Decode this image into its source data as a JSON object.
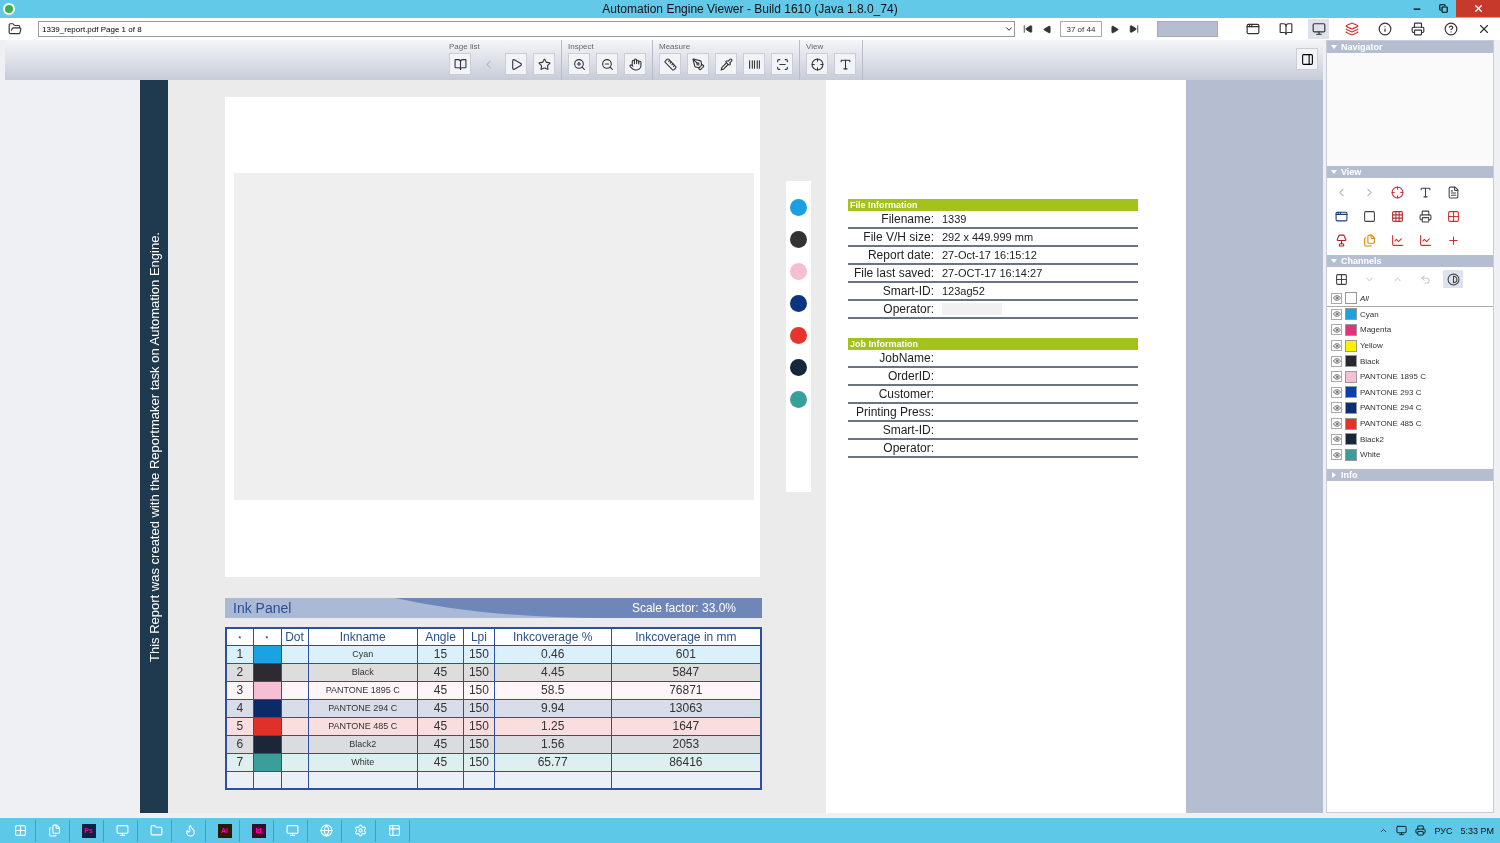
{
  "window": {
    "title": "Automation Engine Viewer - Build 1610 (Java 1.8.0_74)"
  },
  "address_bar": {
    "document": "1339_report.pdf Page 1 of 8",
    "page": "37 of 44"
  },
  "toolbar": {
    "groups": [
      {
        "label": "Page list"
      },
      {
        "label": "Inspect"
      },
      {
        "label": "Measure"
      },
      {
        "label": "View"
      }
    ]
  },
  "report": {
    "side_note": "This Report was created with the Reportmaker task on Automation Engine.",
    "dots": [
      {
        "color": "#1aa0e0"
      },
      {
        "color": "#333333"
      },
      {
        "color": "#f7bdd2"
      },
      {
        "color": "#0a3580"
      },
      {
        "color": "#e8332a"
      },
      {
        "color": "#15273a"
      },
      {
        "color": "#3a9e9a"
      }
    ],
    "ink_panel": {
      "title": "Ink Panel",
      "scale": "Scale factor: 33.0%",
      "columns": [
        "⋆",
        "⋆",
        "Dot",
        "Inkname",
        "Angle",
        "Lpi",
        "Inkcoverage %",
        "Inkcoverage in mm"
      ],
      "rows": [
        {
          "index": "1",
          "color": "#1aa3e2",
          "name": "Cyan",
          "angle": "15",
          "lpi": "150",
          "coverage": "0.46",
          "coverage_mm": "601"
        },
        {
          "index": "2",
          "color": "#2e2a33",
          "name": "Black",
          "angle": "45",
          "lpi": "150",
          "coverage": "4.45",
          "coverage_mm": "5847"
        },
        {
          "index": "3",
          "color": "#f7bfd4",
          "name": "PANTONE 1895 C",
          "angle": "45",
          "lpi": "150",
          "coverage": "58.5",
          "coverage_mm": "76871"
        },
        {
          "index": "4",
          "color": "#0b2a66",
          "name": "PANTONE 294 C",
          "angle": "45",
          "lpi": "150",
          "coverage": "9.94",
          "coverage_mm": "13063"
        },
        {
          "index": "5",
          "color": "#e0302b",
          "name": "PANTONE 485 C",
          "angle": "45",
          "lpi": "150",
          "coverage": "1.25",
          "coverage_mm": "1647"
        },
        {
          "index": "6",
          "color": "#1b2638",
          "name": "Black2",
          "angle": "45",
          "lpi": "150",
          "coverage": "1.56",
          "coverage_mm": "2053"
        },
        {
          "index": "7",
          "color": "#3a9e9b",
          "name": "White",
          "angle": "45",
          "lpi": "150",
          "coverage": "65.77",
          "coverage_mm": "86416"
        }
      ]
    },
    "file_information": {
      "title": "File Information",
      "fields": [
        {
          "label": "Filename:",
          "value": "1339",
          "redacted": false
        },
        {
          "label": "File V/H size:",
          "value": "292 x 449.999 mm",
          "redacted": false
        },
        {
          "label": "Report date:",
          "value": "27-Oct-17 16:15:12",
          "redacted": false
        },
        {
          "label": "File last saved:",
          "value": "27-OCT-17 16:14:27",
          "redacted": false
        },
        {
          "label": "Smart-ID:",
          "value": "123ag52",
          "redacted": false
        },
        {
          "label": "Operator:",
          "redacted": true
        }
      ]
    },
    "job_information": {
      "title": "Job Information",
      "fields": [
        {
          "label": "JobName:"
        },
        {
          "label": "OrderID:"
        },
        {
          "label": "Customer:"
        },
        {
          "label": "Printing Press:"
        },
        {
          "label": "Smart-ID:"
        },
        {
          "label": "Operator:"
        }
      ]
    }
  },
  "side_panel": {
    "navigator": {
      "title": "Navigator",
      "expanded": true
    },
    "view": {
      "title": "View",
      "expanded": true
    },
    "channels": {
      "title": "Channels",
      "expanded": true,
      "items": [
        {
          "kind": "all",
          "name": "All",
          "color": "#ffffff"
        },
        {
          "kind": "ink",
          "name": "Cyan",
          "color": "#1aa3e2"
        },
        {
          "kind": "ink",
          "name": "Magenta",
          "color": "#e8307c"
        },
        {
          "kind": "ink",
          "name": "Yellow",
          "color": "#fff200"
        },
        {
          "kind": "ink",
          "name": "Black",
          "color": "#2a2a2e"
        },
        {
          "kind": "ink",
          "name": "PANTONE 1895 C",
          "color": "#f7bfd4"
        },
        {
          "kind": "ink",
          "name": "PANTONE 293 C",
          "color": "#0b3fb0"
        },
        {
          "kind": "ink",
          "name": "PANTONE 294 C",
          "color": "#0b2f70"
        },
        {
          "kind": "ink",
          "name": "PANTONE 485 C",
          "color": "#e5302a"
        },
        {
          "kind": "ink",
          "name": "Black2",
          "color": "#17273a"
        },
        {
          "kind": "ink",
          "name": "White",
          "color": "#3a9e9a"
        }
      ]
    },
    "info": {
      "title": "Info",
      "expanded": false
    }
  },
  "taskbar": {
    "apps": [
      {
        "kind": "glyph"
      },
      {
        "kind": "glyph"
      },
      {
        "kind": "badge",
        "label": "Ps",
        "color": "#0a2240"
      },
      {
        "kind": "glyph"
      },
      {
        "kind": "glyph"
      },
      {
        "kind": "glyph"
      },
      {
        "kind": "badge",
        "label": "Ai",
        "color": "#2b1a05"
      },
      {
        "kind": "badge",
        "label": "Id",
        "color": "#3c0a2a"
      },
      {
        "kind": "glyph"
      },
      {
        "kind": "glyph"
      },
      {
        "kind": "glyph"
      },
      {
        "kind": "glyph"
      }
    ],
    "language": "РУС",
    "time": "5:33 PM"
  }
}
